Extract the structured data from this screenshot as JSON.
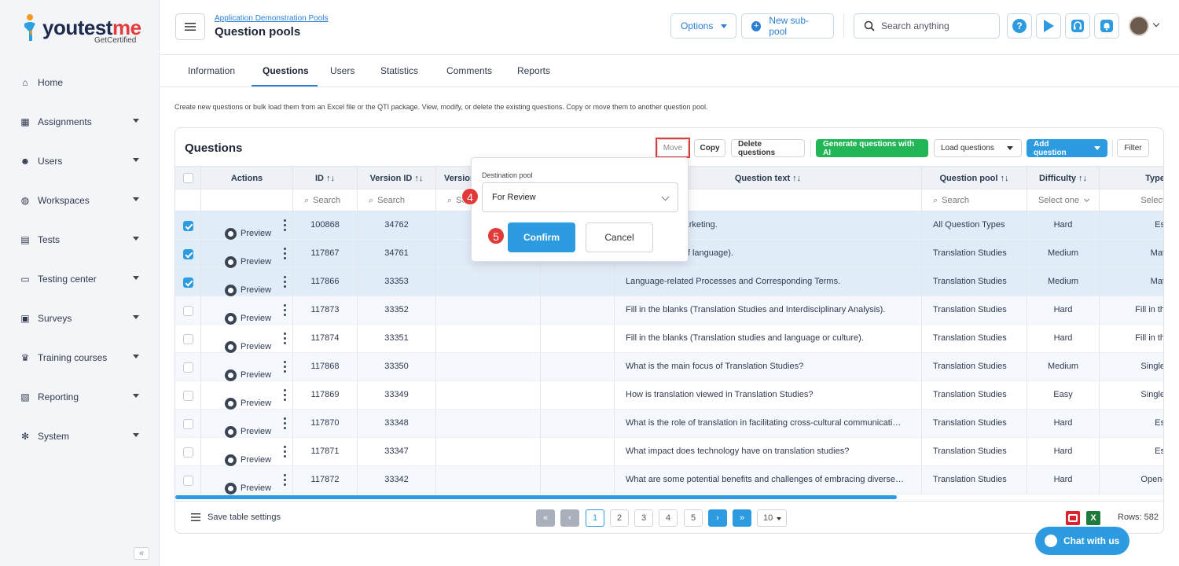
{
  "app": {
    "brand_main": "youtest",
    "brand_accent": "me",
    "brand_sub": "GetCertified"
  },
  "sidebar": {
    "items": [
      {
        "label": "Home",
        "icon": "home-icon",
        "caret": false
      },
      {
        "label": "Assignments",
        "icon": "assignments-icon",
        "caret": true
      },
      {
        "label": "Users",
        "icon": "users-icon",
        "caret": true
      },
      {
        "label": "Workspaces",
        "icon": "globe-icon",
        "caret": true
      },
      {
        "label": "Tests",
        "icon": "tests-icon",
        "caret": true
      },
      {
        "label": "Testing center",
        "icon": "testing-center-icon",
        "caret": true
      },
      {
        "label": "Surveys",
        "icon": "surveys-icon",
        "caret": true
      },
      {
        "label": "Training courses",
        "icon": "trophy-icon",
        "caret": true
      },
      {
        "label": "Reporting",
        "icon": "reporting-icon",
        "caret": true
      },
      {
        "label": "System",
        "icon": "gear-icon",
        "caret": true
      }
    ],
    "collapse_glyph": "«"
  },
  "header": {
    "breadcrumb": "Application Demonstration Pools",
    "title": "Question pools",
    "options_label": "Options",
    "new_subpool_label": "New sub-pool",
    "search_placeholder": "Search anything"
  },
  "tabs": [
    "Information",
    "Questions",
    "Users",
    "Statistics",
    "Comments",
    "Reports"
  ],
  "description": "Create new questions or bulk load them from an Excel file or the QTI package. View, modify, or delete the existing questions. Copy or move them to another question pool.",
  "card": {
    "title": "Questions",
    "toolbar": {
      "move": "Move",
      "copy": "Copy",
      "delete": "Delete questions",
      "generate": "Generate questions with AI",
      "load": "Load questions",
      "add": "Add question",
      "filter": "Filter"
    }
  },
  "table": {
    "headers": {
      "actions": "Actions",
      "id": "ID ↑↓",
      "version_id": "Version ID ↑↓",
      "version": "Version",
      "question_text": "Question text ↑↓",
      "question_pool": "Question pool ↑↓",
      "difficulty": "Difficulty ↑↓",
      "type": "Type"
    },
    "filters": {
      "id": "Search",
      "version_id": "Search",
      "version": "Search",
      "question_pool": "Search",
      "difficulty": "Select one",
      "type": "Select"
    },
    "preview_label": "Preview",
    "rows": [
      {
        "selected": true,
        "id": "100868",
        "version_id": "34762",
        "text": "ncept of viral marketing.",
        "pool": "All Question Types",
        "difficulty": "Hard",
        "type": "Es"
      },
      {
        "selected": true,
        "id": "117867",
        "version_id": "34761",
        "text": "logically (Type of language).",
        "pool": "Translation Studies",
        "difficulty": "Medium",
        "type": "Mat"
      },
      {
        "selected": true,
        "id": "117866",
        "version_id": "33353",
        "text": "Language-related Processes and Corresponding Terms.",
        "pool": "Translation Studies",
        "difficulty": "Medium",
        "type": "Mat"
      },
      {
        "selected": false,
        "id": "117873",
        "version_id": "33352",
        "text": "Fill in the blanks (Translation Studies and Interdisciplinary Analysis).",
        "pool": "Translation Studies",
        "difficulty": "Hard",
        "type": "Fill in th"
      },
      {
        "selected": false,
        "id": "117874",
        "version_id": "33351",
        "text": "Fill in the blanks (Translation studies and language or culture).",
        "pool": "Translation Studies",
        "difficulty": "Hard",
        "type": "Fill in th"
      },
      {
        "selected": false,
        "id": "117868",
        "version_id": "33350",
        "text": "What is the main focus of Translation Studies?",
        "pool": "Translation Studies",
        "difficulty": "Medium",
        "type": "Single"
      },
      {
        "selected": false,
        "id": "117869",
        "version_id": "33349",
        "text": "How is translation viewed in Translation Studies?",
        "pool": "Translation Studies",
        "difficulty": "Easy",
        "type": "Single"
      },
      {
        "selected": false,
        "id": "117870",
        "version_id": "33348",
        "text": "What is the role of translation in facilitating cross-cultural communicati…",
        "pool": "Translation Studies",
        "difficulty": "Hard",
        "type": "Es"
      },
      {
        "selected": false,
        "id": "117871",
        "version_id": "33347",
        "text": "What impact does technology have on translation studies?",
        "pool": "Translation Studies",
        "difficulty": "Hard",
        "type": "Es"
      },
      {
        "selected": false,
        "id": "117872",
        "version_id": "33342",
        "text": "What are some potential benefits and challenges of embracing diverse…",
        "pool": "Translation Studies",
        "difficulty": "Hard",
        "type": "Open-"
      }
    ]
  },
  "footer": {
    "save_settings": "Save table settings",
    "pages": [
      "1",
      "2",
      "3",
      "4",
      "5"
    ],
    "current_page": "1",
    "page_size": "10",
    "rows_label": "Rows: 582"
  },
  "popover": {
    "label": "Destination pool",
    "selected": "For Review",
    "confirm": "Confirm",
    "cancel": "Cancel",
    "step_select": "4",
    "step_confirm": "5"
  },
  "chat": {
    "label": "Chat with us"
  },
  "colors": {
    "accent": "#2d9be0",
    "green": "#22b657",
    "red_marker": "#e03a3a",
    "selected_row": "#e1ecf9"
  }
}
